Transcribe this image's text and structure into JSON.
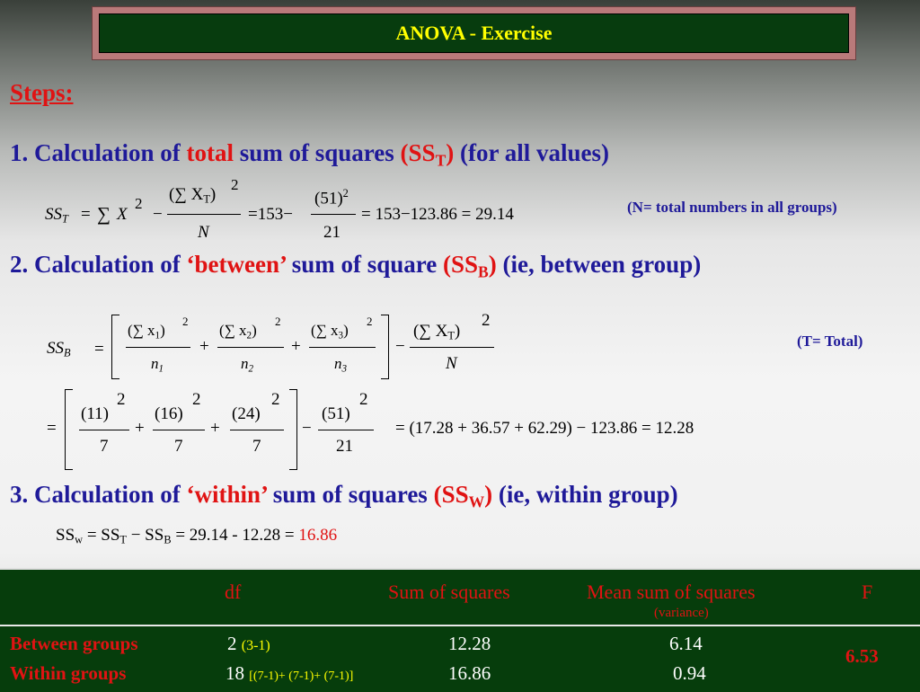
{
  "title": "ANOVA - Exercise",
  "steps_label": "Steps:",
  "step1": {
    "prefix": "1. Calculation of ",
    "highlight": "total",
    "middle": " sum of squares ",
    "ss": "(SS",
    "sub": "T",
    "close": ")",
    "suffix": " (for all values)",
    "note": "(N= total numbers in all groups)",
    "formula": {
      "lhs": "SS",
      "lhs_sub": "T",
      "eq": "=",
      "sum": "∑",
      "x": "X",
      "sq": "2",
      "minus": "−",
      "num": "(∑ X",
      "num_sub": "T",
      "num_close": ")",
      "den": "N",
      "eq2": "=153−",
      "num2": "(51)",
      "num2_sup": "2",
      "den2": "21",
      "tail": "=  153−123.86   =  29.14"
    }
  },
  "step2": {
    "prefix": "2. Calculation of ",
    "highlight": "‘between’",
    "middle": " sum of square ",
    "ss": "(SS",
    "sub": "B",
    "close": ")",
    "suffix": " (ie, between group)",
    "note": "(T= Total)",
    "formula1": {
      "lhs": "SS",
      "lhs_sub": "B",
      "eq": "=",
      "t1_num": "(∑ x",
      "t1_sub": "1",
      "t1_den": "n",
      "t1_den_sub": "1",
      "t2_num": "(∑ x",
      "t2_sub": "2",
      "t2_den": "n",
      "t2_den_sub": "2",
      "t3_num": "(∑ x",
      "t3_sub": "3",
      "t3_den": "n",
      "t3_den_sub": "3",
      "plus": "+",
      "minus": "−",
      "tt_num": "(∑ X",
      "tt_sub": "T",
      "tt_den": "N",
      "close": ")",
      "sq": "2"
    },
    "formula2": {
      "eq": "=",
      "n1": "(11)",
      "n2": "(16)",
      "n3": "(24)",
      "n4": "(51)",
      "d1": "7",
      "d2": "7",
      "d3": "7",
      "d4": "21",
      "sq": "2",
      "plus": "+",
      "minus": "−",
      "tail": "=  (17.28 + 36.57 + 62.29) − 123.86   =  12.28"
    }
  },
  "step3": {
    "prefix": "3. Calculation of ",
    "highlight": "‘within’",
    "middle": " sum of squares ",
    "ss": "(SS",
    "sub": "W",
    "close": ")",
    "suffix": " (ie, within group)",
    "formula": {
      "text_a": "SS",
      "sub_w": "w",
      "text_b": " =  SS",
      "sub_t": "T",
      "text_c": "  −  SS",
      "sub_b": "B",
      "text_d": "    =  29.14  -  12.28  =  ",
      "result": "16.86"
    }
  },
  "table": {
    "headers": {
      "df": "df",
      "ss": "Sum of squares",
      "ms": "Mean sum of squares",
      "ms_sub": "(variance)",
      "f": "F"
    },
    "rows": [
      {
        "label": "Between groups",
        "df": "2",
        "df_note": "(3-1)",
        "ss": "12.28",
        "ms": "6.14"
      },
      {
        "label": "Within groups",
        "df": "18",
        "df_note": "[(7-1)+ (7-1)+ (7-1)]",
        "ss": "16.86",
        "ms": "0.94"
      }
    ],
    "f_value": "6.53"
  },
  "colors": {
    "heading": "#1f1a99",
    "highlight": "#e01313",
    "title_text": "#ffff00",
    "title_bg": "#073c0e",
    "table_bg": "#063d0c"
  }
}
